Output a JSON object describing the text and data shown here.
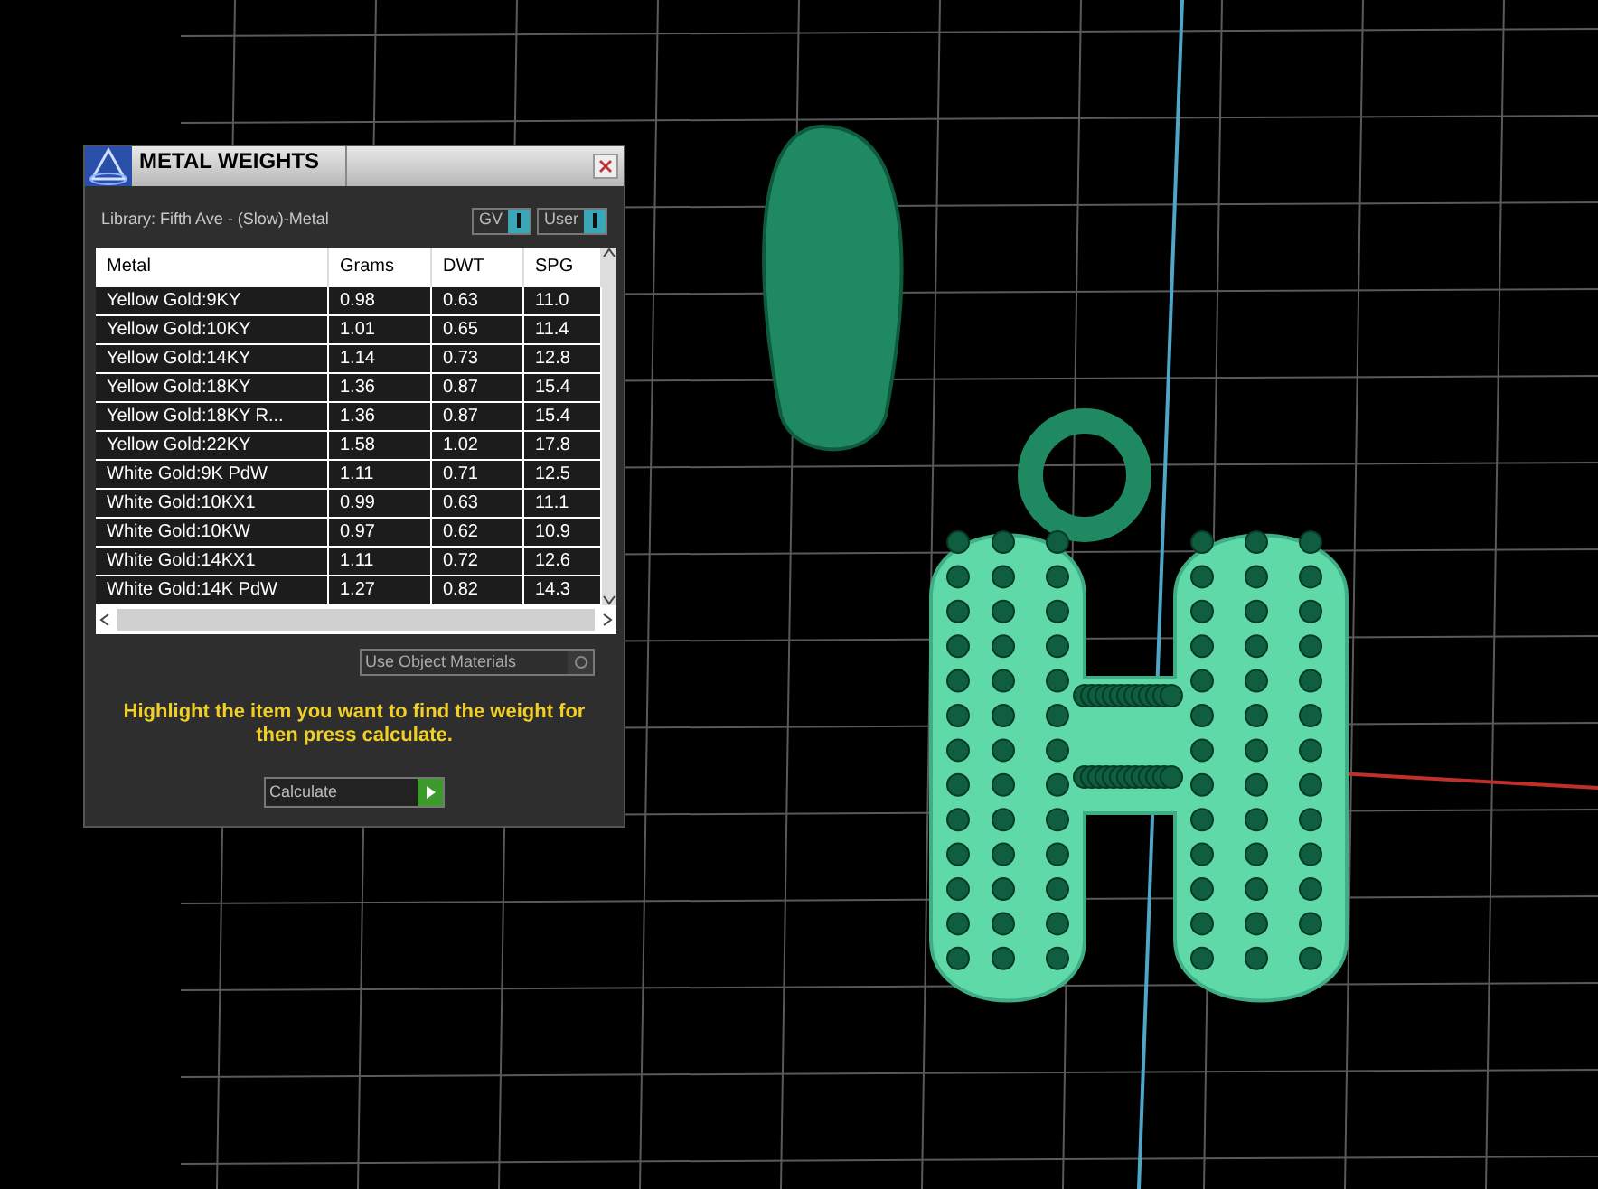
{
  "dialog": {
    "title": "METAL WEIGHTS",
    "library": "Library: Fifth Ave - (Slow)-Metal",
    "toggles": [
      {
        "label": "GV",
        "on": true
      },
      {
        "label": "User",
        "on": true
      }
    ],
    "table": {
      "columns": [
        "Metal",
        "Grams",
        "DWT",
        "SPG"
      ],
      "rows": [
        [
          "Yellow Gold:9KY",
          "0.98",
          "0.63",
          "11.0"
        ],
        [
          "Yellow Gold:10KY",
          "1.01",
          "0.65",
          "11.4"
        ],
        [
          "Yellow Gold:14KY",
          "1.14",
          "0.73",
          "12.8"
        ],
        [
          "Yellow Gold:18KY",
          "1.36",
          "0.87",
          "15.4"
        ],
        [
          "Yellow Gold:18KY R...",
          "1.36",
          "0.87",
          "15.4"
        ],
        [
          "Yellow Gold:22KY",
          "1.58",
          "1.02",
          "17.8"
        ],
        [
          "White Gold:9K PdW",
          "1.11",
          "0.71",
          "12.5"
        ],
        [
          "White Gold:10KX1",
          "0.99",
          "0.63",
          "11.1"
        ],
        [
          "White Gold:10KW",
          "0.97",
          "0.62",
          "10.9"
        ],
        [
          "White Gold:14KX1",
          "1.11",
          "0.72",
          "12.6"
        ],
        [
          "White Gold:14K PdW",
          "1.27",
          "0.82",
          "14.3"
        ]
      ]
    },
    "option": {
      "label": "Use Object Materials",
      "checked": false
    },
    "instruction": "Highlight the item you want to find the weight for then press calculate.",
    "button": "Calculate"
  }
}
